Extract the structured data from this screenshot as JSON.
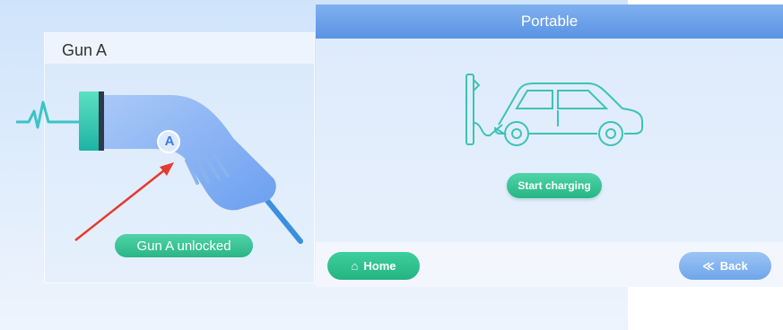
{
  "left_card": {
    "title": "Gun A",
    "gun_badge": "A",
    "status": "Gun A unlocked"
  },
  "panel": {
    "title": "Portable",
    "start_button": "Start charging"
  },
  "footer": {
    "home_label": "Home",
    "home_icon": "⌂",
    "back_label": "Back",
    "back_icon": "≪"
  },
  "colors": {
    "accent_green": "#2bb587",
    "titlebar_blue": "#5a93e4",
    "arrow_red": "#e53b2f",
    "line_teal": "#3cc3c7"
  }
}
